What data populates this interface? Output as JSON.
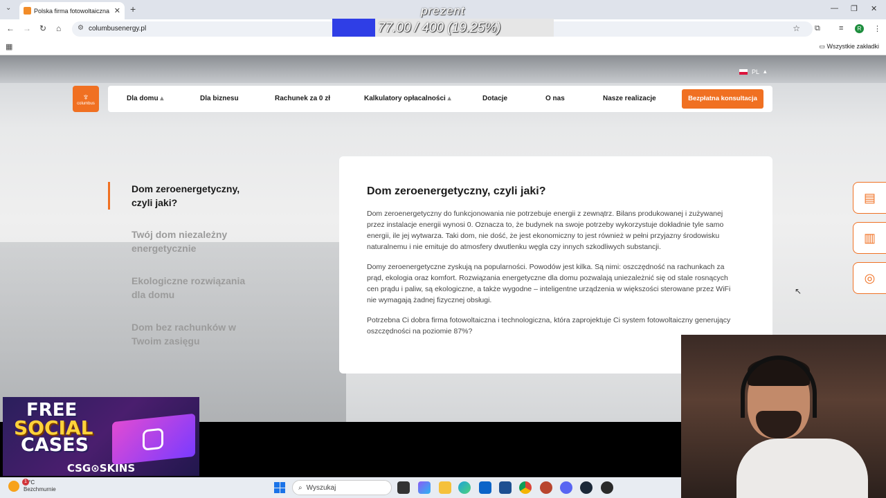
{
  "browser": {
    "tab_title": "Polska firma fotowoltaiczna",
    "tab_close": "✕",
    "new_tab": "+",
    "url": "columbusenergy.pl",
    "bookmarks_all": "Wszystkie zakładki",
    "profile_initial": "R"
  },
  "overlay": {
    "title": "prezent",
    "progress_text": "77.00 / 400 (19.25%)",
    "progress_fraction": 0.1925,
    "progress_color": "#2f3ee6"
  },
  "site": {
    "lang": "PL",
    "logo_text": "columbus",
    "nav": [
      {
        "label": "Dla domu",
        "caret": true
      },
      {
        "label": "Dla biznesu",
        "caret": false
      },
      {
        "label": "Rachunek za 0 zł",
        "caret": false
      },
      {
        "label": "Kalkulatory opłacalności",
        "caret": true
      },
      {
        "label": "Dotacje",
        "caret": false
      },
      {
        "label": "O nas",
        "caret": false
      },
      {
        "label": "Nasze realizacje",
        "caret": false
      }
    ],
    "cta": "Bezpłatna konsultacja",
    "accent": "#f07022",
    "sidebar": [
      {
        "label": "Dom zeroenergetyczny, czyli jaki?",
        "active": true
      },
      {
        "label": "Twój dom niezależny energetycznie",
        "active": false
      },
      {
        "label": "Ekologiczne rozwiązania dla domu",
        "active": false
      },
      {
        "label": "Dom bez rachunków w Twoim zasięgu",
        "active": false
      }
    ],
    "card": {
      "heading": "Dom zeroenergetyczny, czyli jaki?",
      "paragraphs": [
        "Dom zeroenergetyczny do funkcjonowania nie potrzebuje energii z zewnątrz. Bilans produkowanej i zużywanej przez instalacje energii wynosi 0. Oznacza to, że budynek na swoje potrzeby wykorzystuje dokładnie tyle samo energii, ile jej wytwarza. Taki dom, nie dość, że jest ekonomiczny to jest również w pełni przyjazny środowisku naturalnemu i nie emituje do atmosfery dwutlenku węgla czy innych szkodliwych substancji.",
        "Domy zeroenergetyczne zyskują na popularności. Powodów jest kilka. Są nimi: oszczędność na rachunkach za prąd, ekologia oraz komfort. Rozwiązania energetyczne dla domu pozwalają uniezależnić się od stale rosnących cen prądu i paliw, są ekologiczne, a także wygodne – inteligentne urządzenia w większości sterowane przez WiFi nie wymagają żadnej fizycznej obsługi.",
        "Potrzebna Ci dobra firma fotowoltaiczna i technologiczna, która zaprojektuje Ci system fotowoltaiczny generujący oszczędności na poziomie 87%?"
      ]
    },
    "floating_icons": [
      "calculator-icon",
      "document-icon",
      "coins-icon"
    ]
  },
  "ad": {
    "line1": "FREE",
    "line2": "SOCIAL",
    "line3": "CASES",
    "brand": "CSG⊙SKINS"
  },
  "taskbar": {
    "weather_badge": "1",
    "temperature": "-4°C",
    "condition": "Bezchmurnie",
    "search_placeholder": "Wyszukaj"
  }
}
